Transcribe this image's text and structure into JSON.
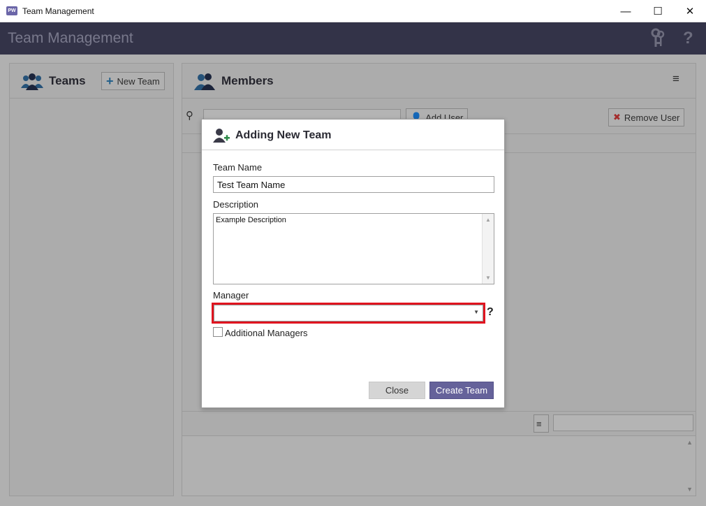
{
  "window": {
    "title": "Team Management",
    "app_icon_text": "PW",
    "minimize": "—",
    "maximize": "☐",
    "close": "✕"
  },
  "header": {
    "title": "Team Management",
    "help": "?"
  },
  "teams_panel": {
    "title": "Teams",
    "new_team_label": "New Team"
  },
  "members_panel": {
    "title": "Members",
    "add_user_label": "Add User",
    "remove_user_label": "Remove User"
  },
  "modal": {
    "title": "Adding New Team",
    "team_name_label": "Team Name",
    "team_name_value": "Test Team Name",
    "description_label": "Description",
    "description_value": "Example Description",
    "manager_label": "Manager",
    "manager_value": "",
    "manager_help": "?",
    "additional_managers_label": "Additional Managers",
    "additional_managers_checked": false,
    "close_label": "Close",
    "create_label": "Create Team"
  },
  "colors": {
    "header_bg": "#3b3b52",
    "primary_button": "#65629a",
    "highlight_border": "#e0141f"
  }
}
